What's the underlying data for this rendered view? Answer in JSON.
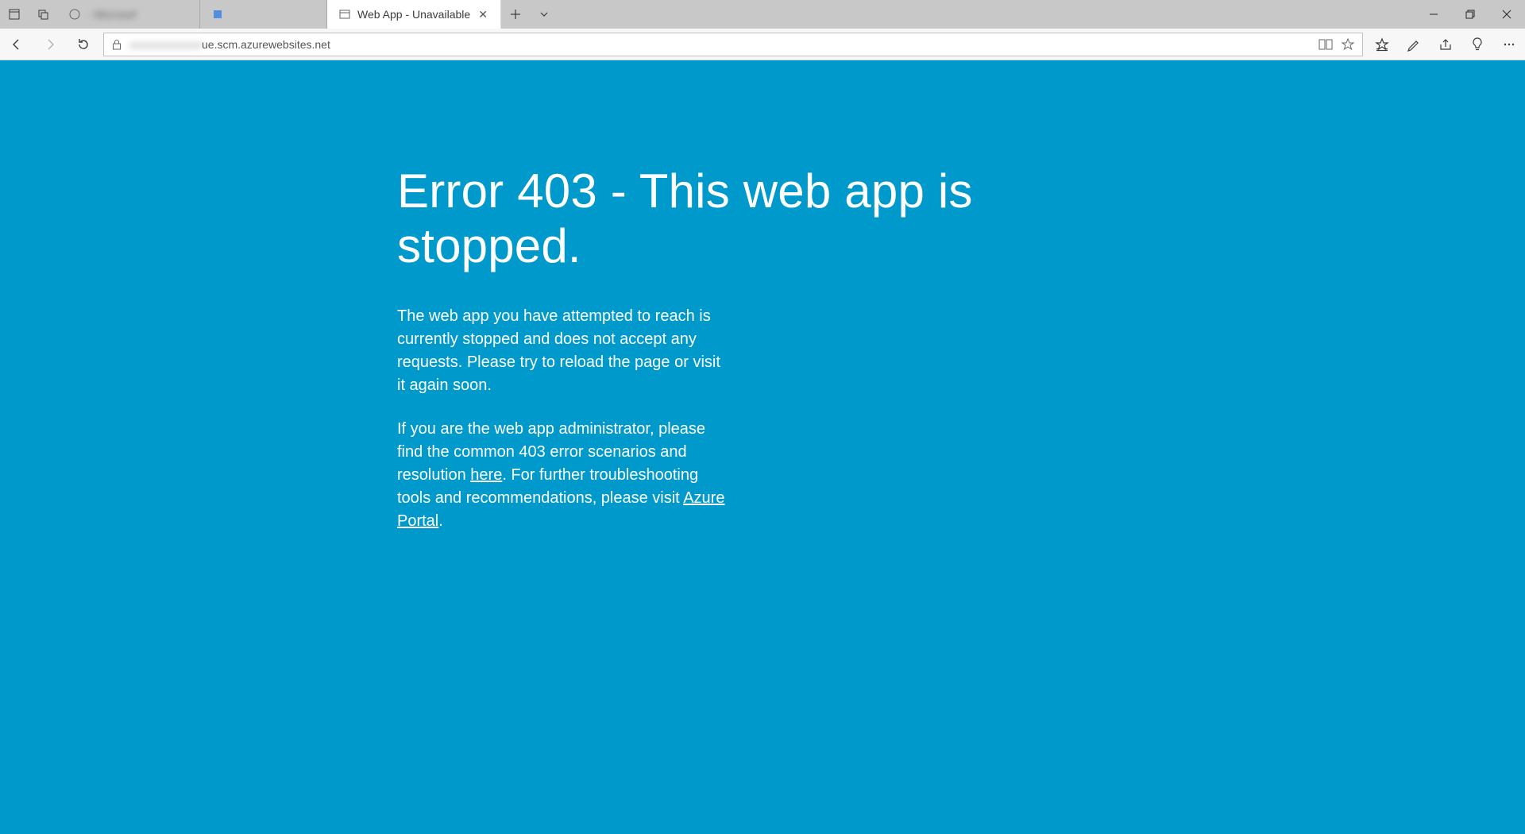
{
  "window": {
    "minimize_tooltip": "Minimize",
    "restore_tooltip": "Restore",
    "close_tooltip": "Close"
  },
  "tabs": [
    {
      "title": "- Microsof",
      "active": false
    },
    {
      "title": " ",
      "active": false
    },
    {
      "title": "Web App - Unavailable",
      "active": true
    }
  ],
  "address_bar": {
    "url_visible_suffix": "ue.scm.azurewebsites.net"
  },
  "page": {
    "heading": "Error 403 - This web app is stopped.",
    "para1": "The web app you have attempted to reach is currently stopped and does not accept any requests. Please try to reload the page or visit it again soon.",
    "para2_pre": "If you are the web app administrator, please find the common 403 error scenarios and resolution ",
    "para2_link1": "here",
    "para2_mid": ". For further troubleshooting tools and recommendations, please visit ",
    "para2_link2": "Azure Portal",
    "para2_post": "."
  }
}
